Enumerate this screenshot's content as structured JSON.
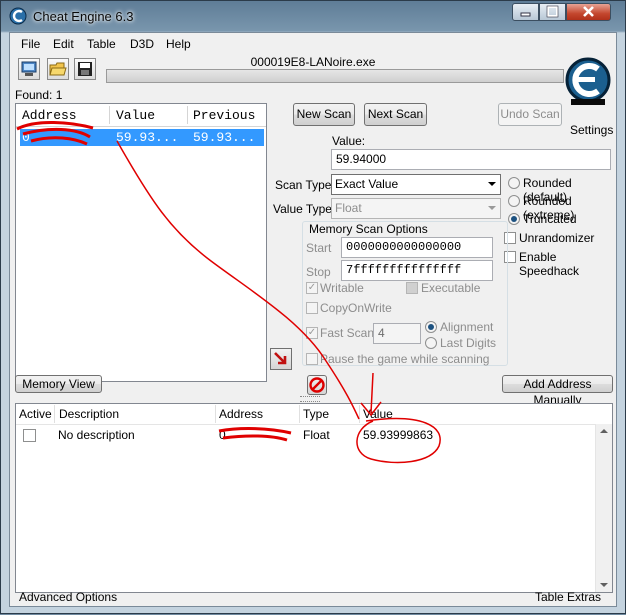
{
  "window": {
    "title": "Cheat Engine 6.3"
  },
  "menu": [
    "File",
    "Edit",
    "Table",
    "D3D",
    "Help"
  ],
  "process": "000019E8-LANoire.exe",
  "found": "Found: 1",
  "settings_label": "Settings",
  "scan_list": {
    "headers": [
      "Address",
      "Value",
      "Previous"
    ],
    "rows": [
      {
        "address": "0",
        "value": "59.93...",
        "previous": "59.93..."
      }
    ]
  },
  "buttons": {
    "new_scan": "New Scan",
    "next_scan": "Next Scan",
    "undo_scan": "Undo Scan",
    "memory_view": "Memory View",
    "add_address": "Add Address Manually"
  },
  "value_field": {
    "label": "Value:",
    "value": "59.94000"
  },
  "scan_type": {
    "label": "Scan Type",
    "selected": "Exact Value"
  },
  "value_type": {
    "label": "Value Type",
    "selected": "Float"
  },
  "rounding": {
    "options": [
      "Rounded (default)",
      "Rounded (extreme)",
      "Truncated"
    ],
    "selected": "Truncated"
  },
  "checks": {
    "unrandomizer": "Unrandomizer",
    "speedhack": "Enable Speedhack"
  },
  "memory_options": {
    "title": "Memory Scan Options",
    "start_label": "Start",
    "start_value": "0000000000000000",
    "stop_label": "Stop",
    "stop_value": "7fffffffffffffff",
    "writable": "Writable",
    "executable": "Executable",
    "copyonwrite": "CopyOnWrite",
    "fast_scan": "Fast Scan",
    "fast_scan_value": "4",
    "alignment": "Alignment",
    "last_digits": "Last Digits",
    "pause": "Pause the game while scanning"
  },
  "address_table": {
    "headers": [
      "Active",
      "Description",
      "Address",
      "Type",
      "Value"
    ],
    "rows": [
      {
        "description": "No description",
        "address": "0",
        "type": "Float",
        "value": "59.93999863"
      }
    ]
  },
  "footer": {
    "left": "Advanced Options",
    "right": "Table Extras"
  },
  "colors": {
    "selection": "#3399ff",
    "annotation": "#e00000"
  }
}
